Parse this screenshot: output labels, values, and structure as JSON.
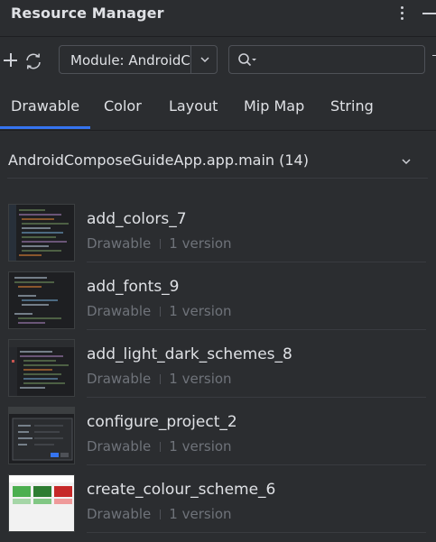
{
  "panel": {
    "title": "Resource Manager",
    "options_icon": "more-vertical-icon",
    "minimize_icon": "minimize-icon"
  },
  "toolbar": {
    "add_icon": "plus-icon",
    "refresh_icon": "refresh-icon",
    "module_select": "Module: AndroidComposeGuideApp.app.main",
    "search_placeholder": "",
    "search_icon": "search-icon"
  },
  "tabs": [
    {
      "label": "Drawable",
      "selected": true
    },
    {
      "label": "Color",
      "selected": false
    },
    {
      "label": "Layout",
      "selected": false
    },
    {
      "label": "Mip Map",
      "selected": false
    },
    {
      "label": "String",
      "selected": false
    }
  ],
  "group": {
    "title": "AndroidComposeGuideApp.app.main (14)",
    "collapse_icon": "chevron-down-icon"
  },
  "items": [
    {
      "name": "add_colors_7",
      "type": "Drawable",
      "versions": "1 version"
    },
    {
      "name": "add_fonts_9",
      "type": "Drawable",
      "versions": "1 version"
    },
    {
      "name": "add_light_dark_schemes_8",
      "type": "Drawable",
      "versions": "1 version"
    },
    {
      "name": "configure_project_2",
      "type": "Drawable",
      "versions": "1 version"
    },
    {
      "name": "create_colour_scheme_6",
      "type": "Drawable",
      "versions": "1 version"
    }
  ],
  "colors": {
    "background": "#2b2d30",
    "text": "#dfe1e5",
    "secondary_text": "#6f737a",
    "accent": "#3574f0",
    "border": "#4e5157"
  }
}
